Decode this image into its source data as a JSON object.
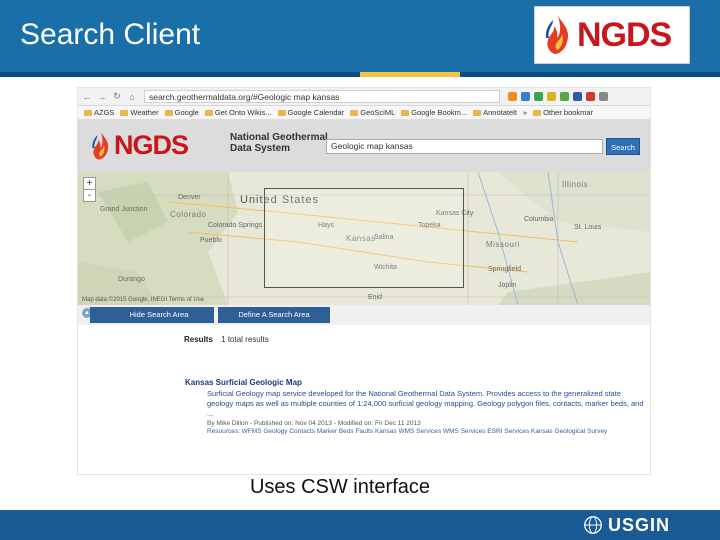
{
  "slide": {
    "title": "Search Client",
    "caption": "Uses CSW interface",
    "header_logo_text": "NGDS",
    "footer_logo_text": "USGIN"
  },
  "browser": {
    "url": "search.geothermaldata.org/#Geologic map kansas",
    "bookmarks": [
      "AZGS",
      "Weather",
      "Google",
      "Get Onto Wikis...",
      "Google Calendar",
      "GeoSciML",
      "Google Bookm...",
      "Annotatelt",
      "»",
      "Other bookmar"
    ]
  },
  "app": {
    "logo_text": "NGDS",
    "subtitle_line1": "National Geothermal",
    "subtitle_line2": "Data System",
    "search_value": "Geologic map kansas",
    "search_button": "Search"
  },
  "map": {
    "country_label": "United States",
    "states": [
      "Colorado",
      "Kansas",
      "Missouri",
      "Illinois"
    ],
    "cities": [
      "Denver",
      "Colorado Springs",
      "Pueblo",
      "Topeka",
      "Kansas City",
      "Wichita",
      "Springfield",
      "St. Louis",
      "Columbia",
      "Salina",
      "Hays",
      "Joplin",
      "Enid",
      "Grand Junction",
      "Durango"
    ],
    "zoom_in": "+",
    "zoom_out": "-",
    "attribution": "Map data ©2015 Google, INEGI  Terms of Use"
  },
  "controls": {
    "hide_label": "Hide Search Area",
    "define_label": "Define A Search Area"
  },
  "results": {
    "label": "Results",
    "count_text": "1 total results",
    "items": [
      {
        "title": "Kansas Surficial Geologic Map",
        "description": "Surficial Geology map service developed for the National Geothermal Data System. Provides access to the generalized state geology maps as well as multiple counties of 1:24,000 surficial geology mapping. Geology polygon files, contacts, marker beds, and ...",
        "meta": "By Mike Dillon - Published on: Nov 04 2013 - Modified on: Fri Dec 11 2013",
        "links": "Resources: WFMS Geology Contacts Marker Beds Faults Kansas WMS Services WMS Services ESRI Services Kansas Geological Survey"
      }
    ]
  },
  "colors": {
    "header_blue": "#1a6fa8",
    "ngds_red": "#c8161d",
    "button_blue": "#2f5f97"
  }
}
